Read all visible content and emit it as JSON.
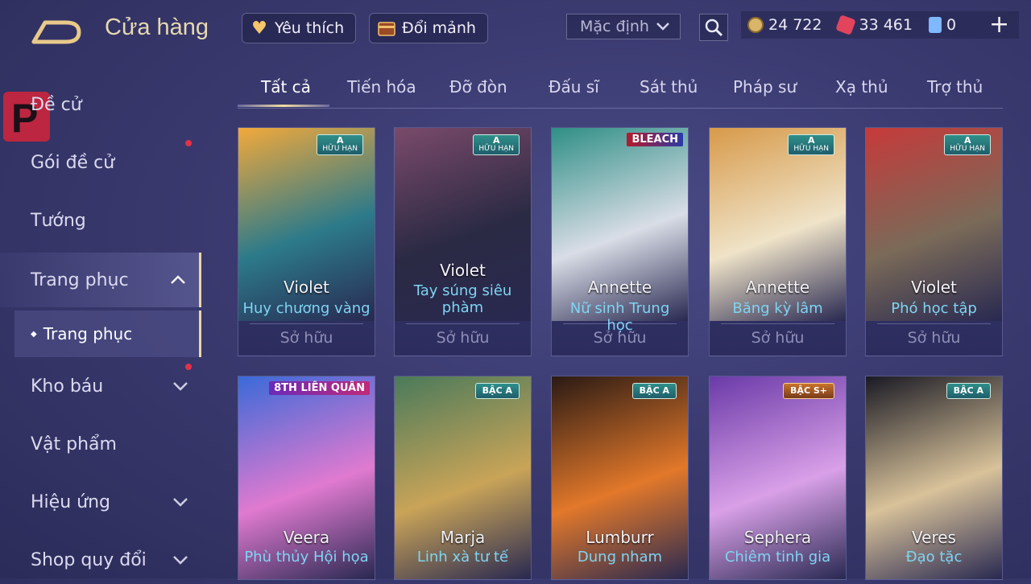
{
  "header": {
    "title": "Cửa hàng",
    "favorites_label": "Yêu thích",
    "exchange_label": "Đổi mảnh",
    "sort_value": "Mặc định",
    "currencies": [
      {
        "name": "gold",
        "value": "24 722",
        "color": "#d9b56a"
      },
      {
        "name": "voucher",
        "value": "33 461",
        "color": "#e2445c"
      },
      {
        "name": "card",
        "value": "0",
        "color": "#7fb8ff"
      }
    ]
  },
  "sidebar": {
    "items": [
      {
        "label": "Đề cử"
      },
      {
        "label": "Gói đề cử"
      },
      {
        "label": "Tướng"
      },
      {
        "label": "Trang phục"
      },
      {
        "label": "Kho báu"
      },
      {
        "label": "Vật phẩm"
      },
      {
        "label": "Hiệu ứng"
      },
      {
        "label": "Shop quy đổi"
      }
    ],
    "sub_item": "Trang phục"
  },
  "tabs": [
    "Tất cả",
    "Tiến hóa",
    "Đỡ đòn",
    "Đấu sĩ",
    "Sát thủ",
    "Pháp sư",
    "Xạ thủ",
    "Trợ thủ"
  ],
  "cards": [
    {
      "hero": "Violet",
      "skin": "Huy chương vàng",
      "status": "Sở hữu",
      "badge": "A",
      "badge_sub": "HỮU HẠN",
      "art": [
        "#f2a93b",
        "#2c7a8a"
      ]
    },
    {
      "hero": "Violet",
      "skin": "Tay súng siêu phàm",
      "status": "Sở hữu",
      "badge": "A",
      "badge_sub": "HỮU HẠN",
      "art": [
        "#7a4a6a",
        "#2b2a44"
      ]
    },
    {
      "hero": "Annette",
      "skin": "Nữ sinh Trung học",
      "status": "Sở hữu",
      "badge": "BLEACH",
      "badge_sub": "",
      "art": [
        "#2f8f86",
        "#d9dde6"
      ]
    },
    {
      "hero": "Annette",
      "skin": "Băng kỳ lâm",
      "status": "Sở hữu",
      "badge": "A",
      "badge_sub": "HỮU HẠN",
      "art": [
        "#d79a4a",
        "#efe3c8"
      ]
    },
    {
      "hero": "Violet",
      "skin": "Phó học tập",
      "status": "Sở hữu",
      "badge": "A",
      "badge_sub": "HỮU HẠN",
      "art": [
        "#c63a3a",
        "#7a6a58"
      ]
    },
    {
      "hero": "Veera",
      "skin": "Phù thủy Hội họa",
      "status": "",
      "badge": "8TH LIÊN QUÂN",
      "badge_sub": "",
      "art": [
        "#3a6ad8",
        "#e07ad0"
      ]
    },
    {
      "hero": "Marja",
      "skin": "Linh xà tư tế",
      "status": "",
      "badge": "BẬC A",
      "badge_sub": "",
      "art": [
        "#4a7a5a",
        "#c9a458"
      ]
    },
    {
      "hero": "Lumburr",
      "skin": "Dung nham",
      "status": "",
      "badge": "BẬC A",
      "badge_sub": "",
      "art": [
        "#2a1a14",
        "#e2782a"
      ]
    },
    {
      "hero": "Sephera",
      "skin": "Chiêm tinh gia",
      "status": "",
      "badge": "BẬC S+",
      "badge_sub": "",
      "art": [
        "#6a3aa8",
        "#d9a0e8"
      ]
    },
    {
      "hero": "Veres",
      "skin": "Đạo tặc",
      "status": "",
      "badge": "BẬC A",
      "badge_sub": "",
      "art": [
        "#1a1a24",
        "#d8c29a"
      ]
    }
  ]
}
